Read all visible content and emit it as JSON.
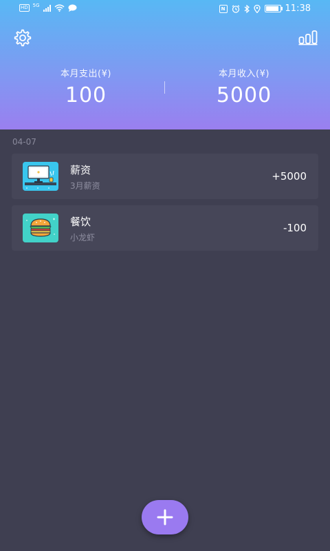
{
  "status_bar": {
    "hd": "HD",
    "network": "5G",
    "nfc": "N",
    "time": "11:38",
    "battery_level": 0.85
  },
  "header": {
    "expense_label": "本月支出(¥)",
    "expense_value": "100",
    "income_label": "本月收入(¥)",
    "income_value": "5000"
  },
  "records": {
    "date": "04-07",
    "items": [
      {
        "title": "薪资",
        "note": "3月薪资",
        "amount": "+5000",
        "icon": "salary-desk-icon"
      },
      {
        "title": "餐饮",
        "note": "小龙虾",
        "amount": "-100",
        "icon": "burger-icon"
      }
    ]
  },
  "colors": {
    "gradient_top": "#58b8f4",
    "gradient_bottom": "#9a7ff0",
    "background": "#3f3f51",
    "card": "#464658",
    "fab": "#9a7af0"
  }
}
